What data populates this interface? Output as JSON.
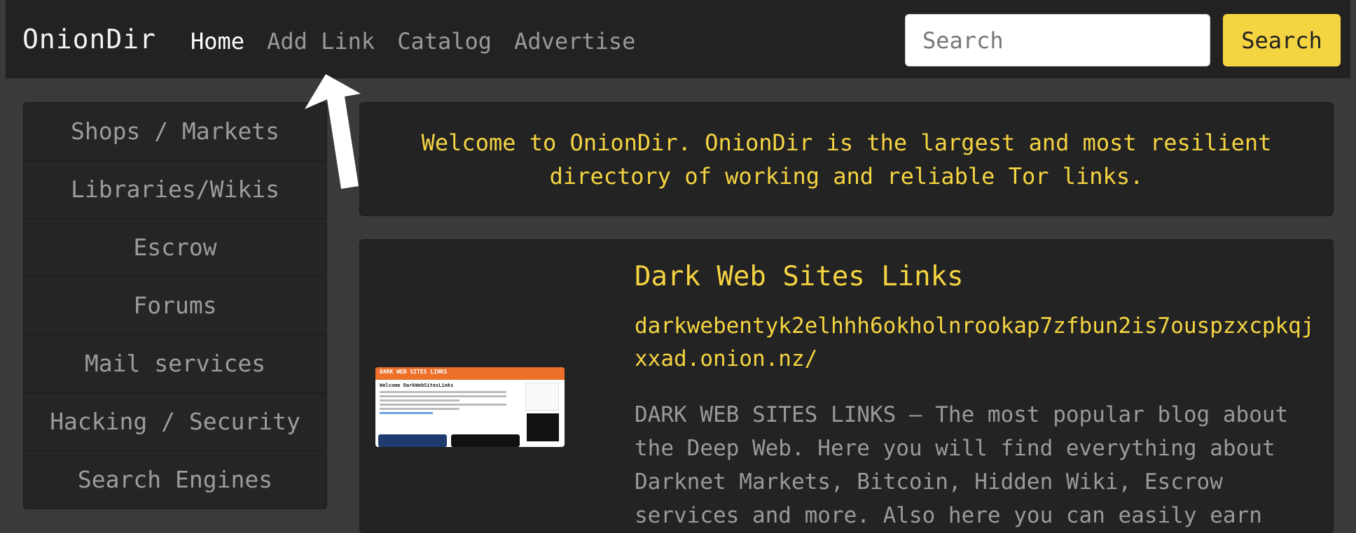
{
  "navbar": {
    "brand": "OnionDir",
    "links": [
      "Home",
      "Add Link",
      "Catalog",
      "Advertise"
    ],
    "search_placeholder": "Search",
    "search_button": "Search"
  },
  "sidebar": {
    "items": [
      "Shops / Markets",
      "Libraries/Wikis",
      "Escrow",
      "Forums",
      "Mail services",
      "Hacking / Security",
      "Search Engines"
    ]
  },
  "welcome": {
    "text": "Welcome to OnionDir. OnionDir is the largest and most resilient directory of working and reliable Tor links."
  },
  "listing": {
    "title": "Dark Web Sites Links",
    "url": "darkwebentyk2elhhh6okholnrookap7zfbun2is7ouspzxcpkqjxxad.onion.nz/",
    "description": "DARK WEB SITES LINKS – The most popular blog about the Deep Web. Here you will find everything about Darknet Markets, Bitcoin, Hidden Wiki, Escrow services and more. Also here you can easily earn",
    "thumbnail": {
      "header": "DARK WEB SITES LINKS",
      "title": "Welcome DarkWebSitesLinks"
    }
  },
  "colors": {
    "accent": "#f5d442",
    "navbar_bg": "#222222",
    "page_bg": "#3a3a3a",
    "panel_bg": "#232323",
    "annotation_arrow": "#ffffff"
  },
  "icons": {
    "annotation": "arrow-up-icon"
  }
}
